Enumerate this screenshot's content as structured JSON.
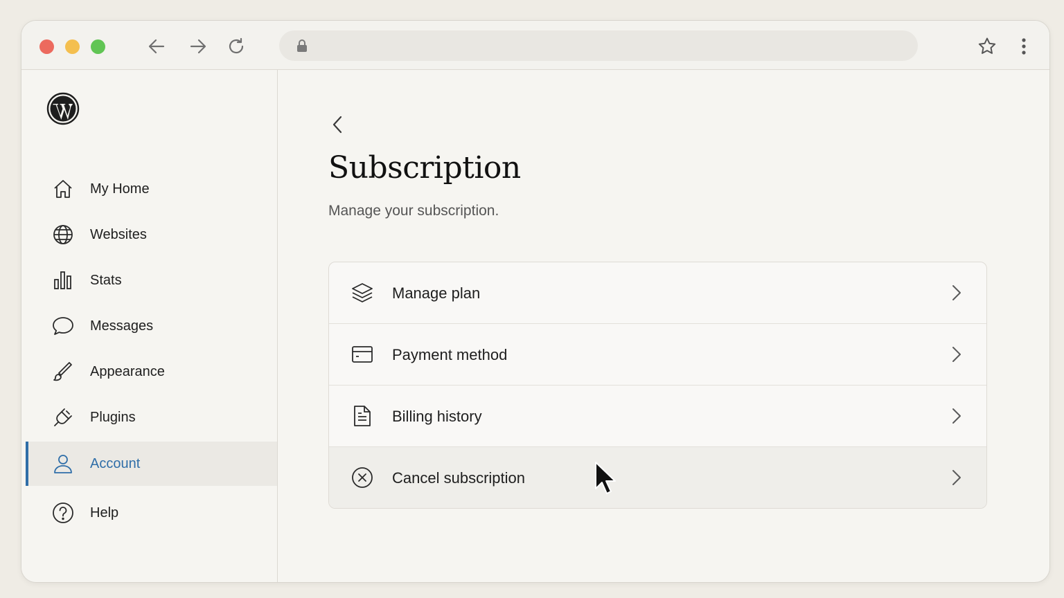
{
  "browser": {
    "address_value": "",
    "icons": [
      "back-arrow-icon",
      "forward-arrow-icon",
      "reload-icon",
      "lock-icon",
      "star-icon",
      "more-vertical-icon"
    ]
  },
  "sidebar": {
    "logo": "wordpress-logo",
    "items": [
      {
        "label": "My Home",
        "icon": "home-icon"
      },
      {
        "label": "Websites",
        "icon": "globe-icon"
      },
      {
        "label": "Stats",
        "icon": "bar-chart-icon"
      },
      {
        "label": "Messages",
        "icon": "chat-bubble-icon"
      },
      {
        "label": "Appearance",
        "icon": "brush-icon"
      },
      {
        "label": "Plugins",
        "icon": "plug-icon"
      },
      {
        "label": "Account",
        "icon": "user-icon",
        "active": true
      },
      {
        "label": "Help",
        "icon": "help-icon"
      }
    ]
  },
  "main": {
    "title": "Subscription",
    "subtitle": "Manage your subscription.",
    "rows": [
      {
        "label": "Manage plan",
        "icon": "layers-icon"
      },
      {
        "label": "Payment method",
        "icon": "credit-card-icon"
      },
      {
        "label": "Billing history",
        "icon": "document-icon"
      },
      {
        "label": "Cancel subscription",
        "icon": "cancel-circle-icon",
        "hovered": true
      }
    ]
  },
  "colors": {
    "accent": "#2f6ea8",
    "background": "#efece5",
    "window": "#f6f5f1",
    "traffic_red": "#ec6a5e",
    "traffic_yellow": "#f4bf4f",
    "traffic_green": "#61c554"
  }
}
